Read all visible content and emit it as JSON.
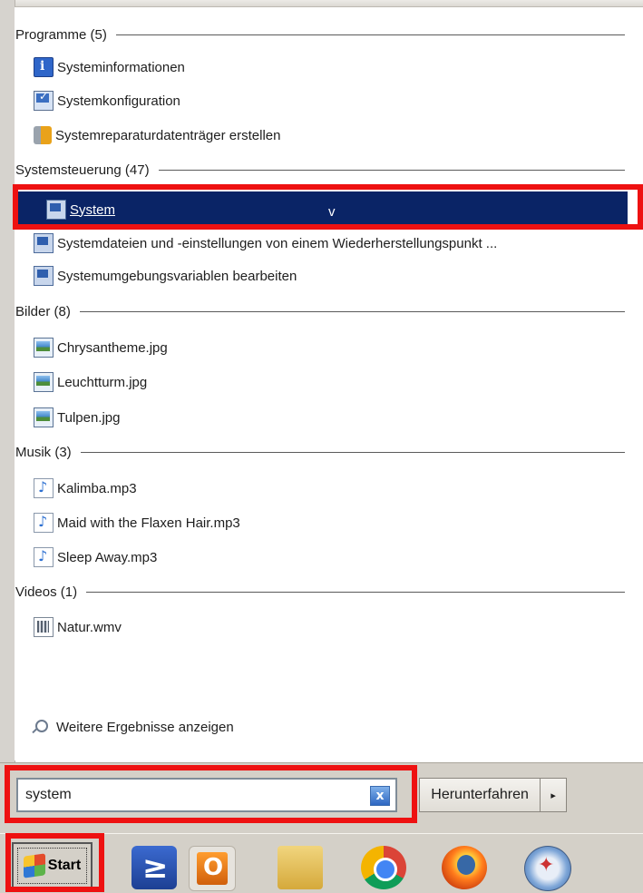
{
  "groups": {
    "programme": {
      "header": "Programme (5)",
      "items": [
        "Systeminformationen",
        "Systemkonfiguration",
        "Systemreparaturdatenträger erstellen"
      ]
    },
    "systemsteuerung": {
      "header": "Systemsteuerung (47)",
      "items": [
        "System",
        "Systemdateien und -einstellungen von einem Wiederherstellungspunkt ...",
        "Systemumgebungsvariablen bearbeiten"
      ],
      "selected_item": "System"
    },
    "bilder": {
      "header": "Bilder (8)",
      "items": [
        "Chrysantheme.jpg",
        "Leuchtturm.jpg",
        "Tulpen.jpg"
      ]
    },
    "musik": {
      "header": "Musik (3)",
      "items": [
        "Kalimba.mp3",
        "Maid with the Flaxen Hair.mp3",
        "Sleep Away.mp3"
      ]
    },
    "videos": {
      "header": "Videos (1)",
      "items": [
        "Natur.wmv"
      ]
    }
  },
  "more_results": "Weitere Ergebnisse anzeigen",
  "search": {
    "value": "system",
    "clear_icon": "x"
  },
  "shutdown": {
    "label": "Herunterfahren",
    "arrow_icon": "▸"
  },
  "taskbar": {
    "start_label": "Start",
    "apps": [
      "powershell-icon",
      "outlook-icon",
      "explorer-icon",
      "chrome-icon",
      "firefox-icon",
      "safari-icon"
    ]
  },
  "highlight_color": "#e11111",
  "selection_color": "#0a2466",
  "stray_glyph": "v"
}
